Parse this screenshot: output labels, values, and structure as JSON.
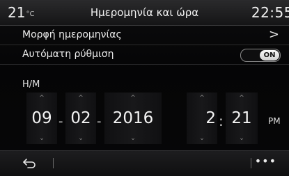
{
  "header": {
    "temperature": "21",
    "temperature_unit": "°C",
    "title": "Ημερομηνία και ώρα",
    "clock": "22:55"
  },
  "settings": {
    "date_format_label": "Μορφή ημερομηνίας",
    "auto_setting_label": "Αυτόματη ρύθμιση",
    "auto_setting_value": "ON"
  },
  "date_time": {
    "section_label": "Η/Μ",
    "day": "09",
    "month": "02",
    "year": "2016",
    "hour": "2",
    "minute": "21",
    "date_separator": "-",
    "time_separator": ":",
    "ampm": "PM"
  },
  "footer": {
    "more_label": "•••"
  }
}
